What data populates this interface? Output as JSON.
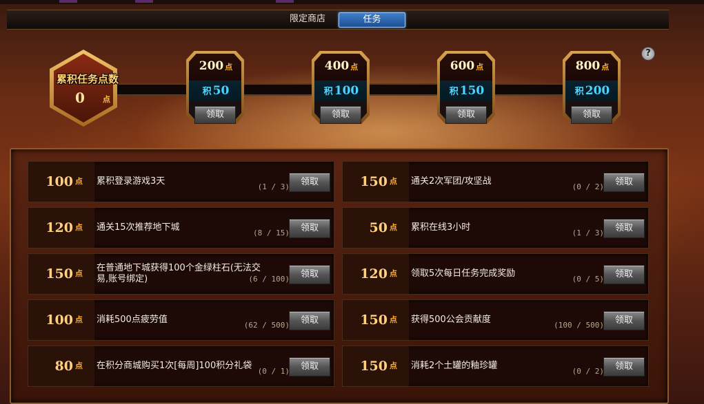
{
  "tabs": [
    {
      "label": "限定商店",
      "active": false
    },
    {
      "label": "任务",
      "active": true
    }
  ],
  "help_icon": "?",
  "total": {
    "label": "累积任务点数",
    "value": "0",
    "unit": "点"
  },
  "milestones": [
    {
      "points": "200",
      "unit": "点",
      "reward_prefix": "积",
      "reward": "50",
      "button": "领取"
    },
    {
      "points": "400",
      "unit": "点",
      "reward_prefix": "积",
      "reward": "100",
      "button": "领取"
    },
    {
      "points": "600",
      "unit": "点",
      "reward_prefix": "积",
      "reward": "150",
      "button": "领取"
    },
    {
      "points": "800",
      "unit": "点",
      "reward_prefix": "积",
      "reward": "200",
      "button": "领取"
    }
  ],
  "tasks": [
    {
      "points": "100",
      "unit": "点",
      "name": "累积登录游戏3天",
      "progress": "(1 / 3)",
      "button": "领取"
    },
    {
      "points": "150",
      "unit": "点",
      "name": "通关2次军团/攻坚战",
      "progress": "(0 / 2)",
      "button": "领取"
    },
    {
      "points": "120",
      "unit": "点",
      "name": "通关15次推荐地下城",
      "progress": "(8 / 15)",
      "button": "领取"
    },
    {
      "points": "50",
      "unit": "点",
      "name": "累积在线3小时",
      "progress": "(1 / 3)",
      "button": "领取"
    },
    {
      "points": "150",
      "unit": "点",
      "name": "在普通地下城获得100个金绿柱石(无法交易,账号绑定)",
      "progress": "(6 / 100)",
      "button": "领取"
    },
    {
      "points": "120",
      "unit": "点",
      "name": "领取5次每日任务完成奖励",
      "progress": "(0 / 5)",
      "button": "领取"
    },
    {
      "points": "100",
      "unit": "点",
      "name": "消耗500点疲劳值",
      "progress": "(62 / 500)",
      "button": "领取"
    },
    {
      "points": "150",
      "unit": "点",
      "name": "获得500公会贡献度",
      "progress": "(100 / 500)",
      "button": "领取"
    },
    {
      "points": "80",
      "unit": "点",
      "name": "在积分商城购买1次[每周]100积分礼袋",
      "progress": "(0 / 1)",
      "button": "领取"
    },
    {
      "points": "150",
      "unit": "点",
      "name": "消耗2个土罐的釉珍罐",
      "progress": "(0 / 2)",
      "button": "领取"
    }
  ]
}
